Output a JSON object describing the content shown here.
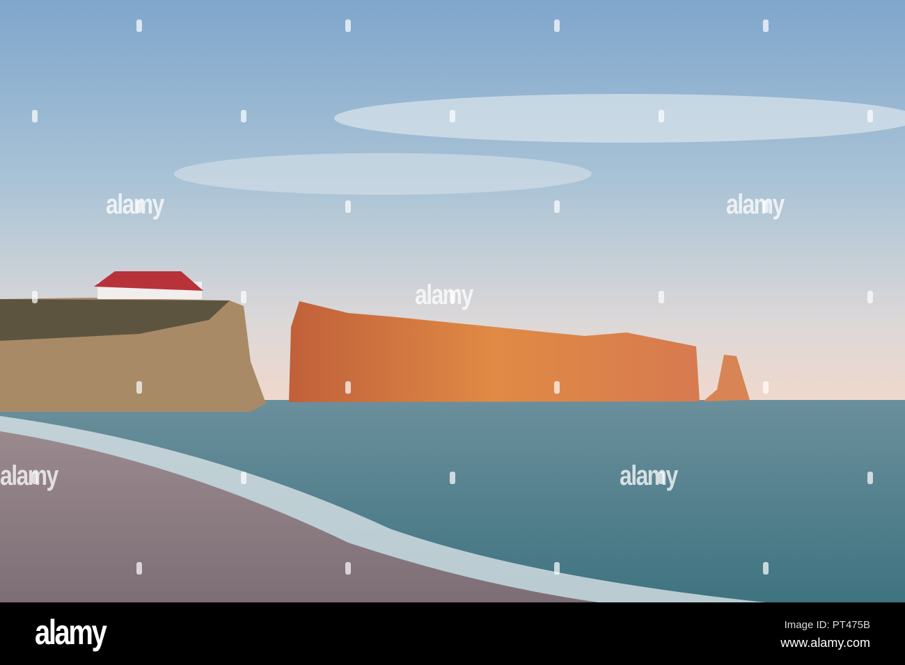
{
  "watermark": {
    "text": "alamy"
  },
  "footer": {
    "logo": "alamy",
    "image_id": "Image ID: PT475B",
    "website": "www.alamy.com"
  },
  "colors": {
    "sky_top": "#7fa6cc",
    "sky_horizon": "#eed9cf",
    "sea": "#4f7f8c",
    "rock": "#d8753f",
    "beach": "#8e8088"
  }
}
